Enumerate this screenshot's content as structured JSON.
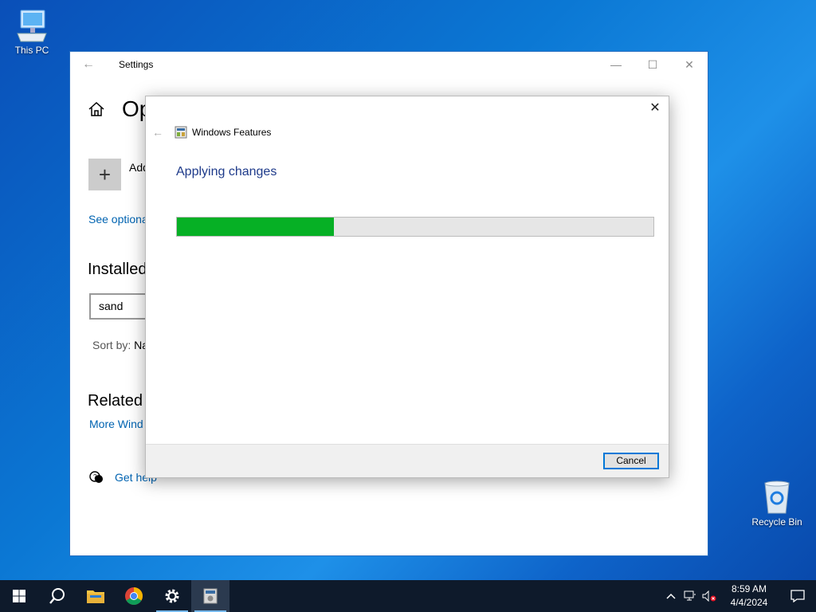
{
  "desktop": {
    "this_pc_label": "This PC",
    "recycle_bin_label": "Recycle Bin"
  },
  "settings": {
    "title": "Settings",
    "heading": "Op",
    "add_label": "Add",
    "see_optional": "See optiona",
    "installed_title": "Installed",
    "search_value": "sand",
    "sort_label": "Sort by: ",
    "sort_value": "Na",
    "related_title": "Related",
    "more_windows": "More Wind",
    "get_help": "Get help"
  },
  "dialog": {
    "title": "Windows Features",
    "status": "Applying changes",
    "progress_fraction": 0.33,
    "cancel_label": "Cancel"
  },
  "taskbar": {
    "time": "8:59 AM",
    "date": "4/4/2024"
  },
  "colors": {
    "accent": "#0078d7",
    "progress_fill": "#06b025",
    "link": "#0063b1",
    "heading_blue": "#1e3a8a",
    "taskbar": "#0e1a2b"
  },
  "icons": [
    "monitor-icon",
    "recycle-bin-icon",
    "back-arrow-icon",
    "home-icon",
    "plus-icon",
    "chat-help-icon",
    "close-icon",
    "minimize-icon",
    "maximize-icon",
    "windows-features-icon",
    "start-icon",
    "search-icon",
    "file-explorer-icon",
    "chrome-icon",
    "gear-icon",
    "chevron-up-icon",
    "network-icon",
    "volume-muted-icon",
    "notification-icon"
  ]
}
